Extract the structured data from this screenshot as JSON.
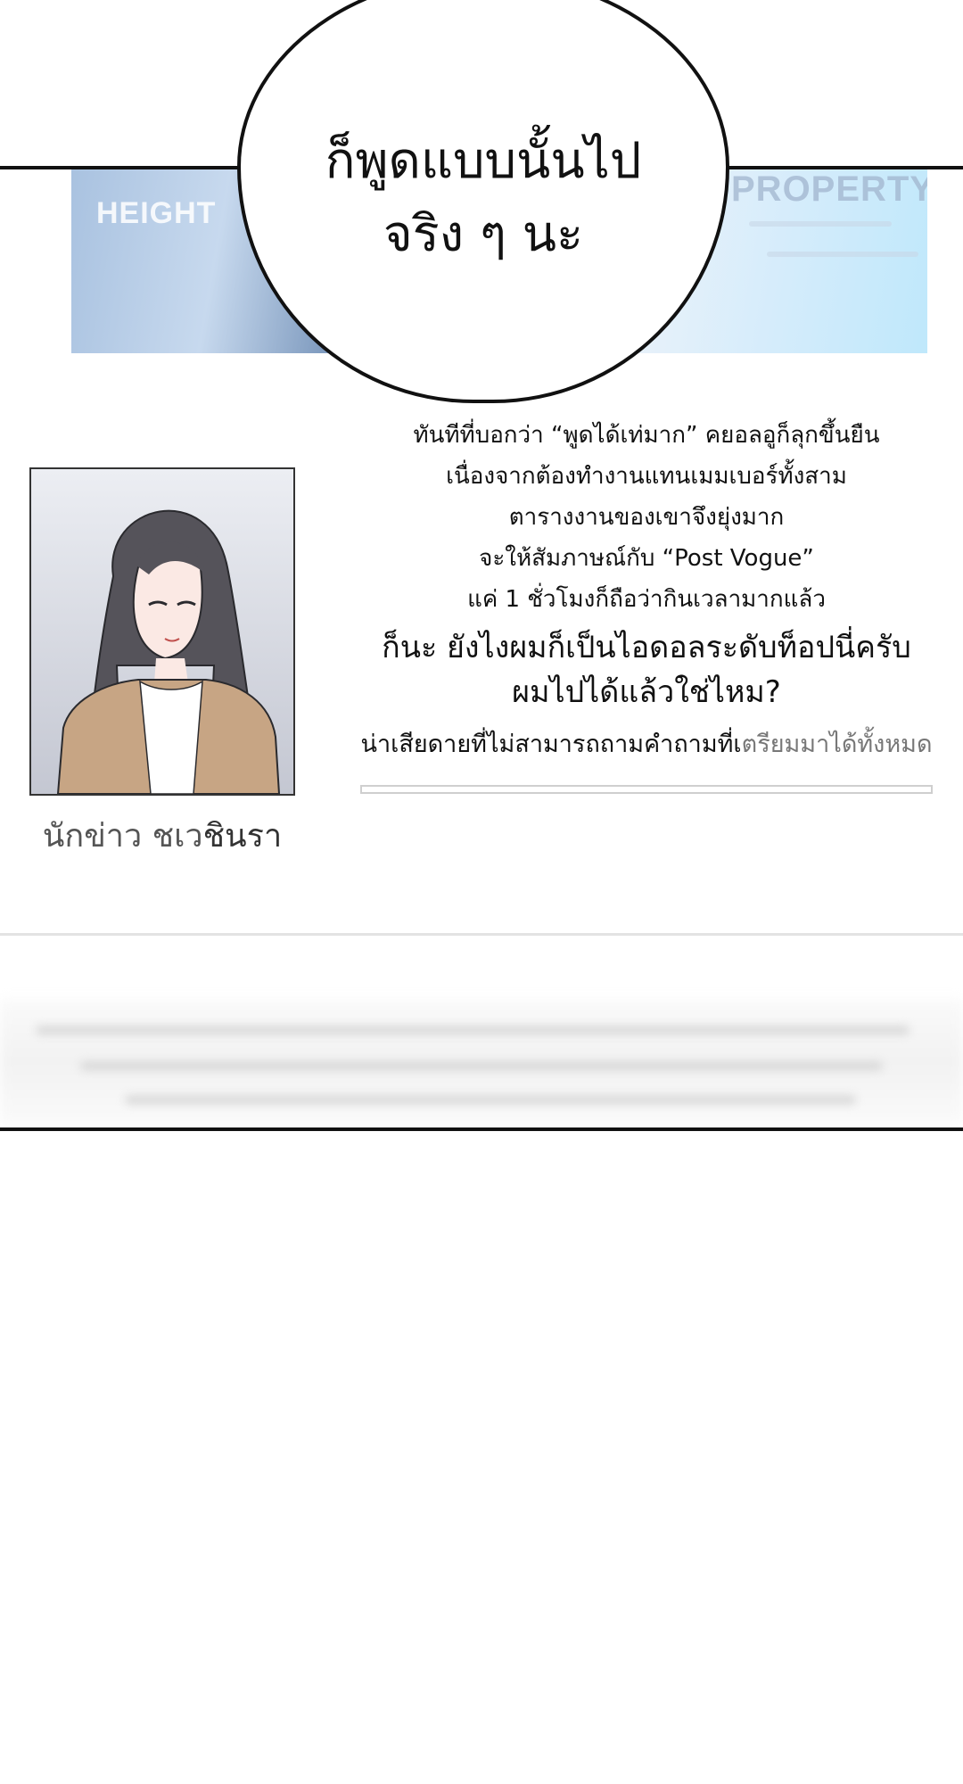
{
  "banner": {
    "left_label": "HEIGHT",
    "right_label": "PROPERTY:"
  },
  "bubble": {
    "line1": "ก็พูดแบบนั้นไป",
    "line2": "จริง ๆ นะ"
  },
  "profile": {
    "caption_prefix": "นักข่าว ชเว",
    "caption_name": "ชินรา"
  },
  "article": {
    "lines": [
      "ทันทีที่บอกว่า “พูดได้เท่มาก” คยอลอูก็ลุกขึ้นยืน",
      "เนื่องจากต้องทำงานแทนเมมเบอร์ทั้งสาม",
      "ตารางงานของเขาจึงยุ่งมาก",
      "จะให้สัมภาษณ์กับ “Post Vogue”",
      "แค่ 1 ชั่วโมงก็ถือว่ากินเวลามากแล้ว"
    ],
    "quote_lines": [
      "ก็นะ ยังไงผมก็เป็นไอดอลระดับท็อปนี่ครับ",
      "ผมไปได้แล้วใช่ไหม?"
    ],
    "note_main": "น่าเสียดายที่ไม่สามารถถามคำถามที่เ",
    "note_faded": "ตรียมมาได้ทั้งหมด"
  },
  "progress": {
    "value": 0
  }
}
